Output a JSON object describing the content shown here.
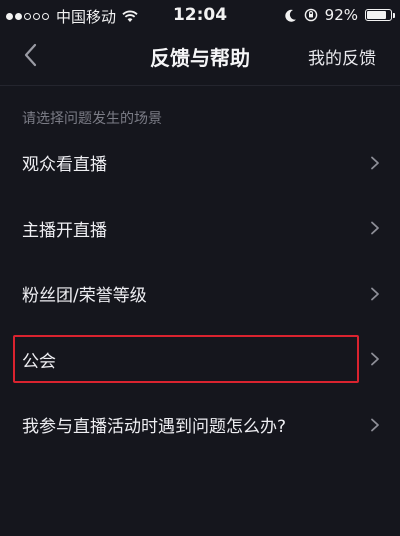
{
  "status_bar": {
    "carrier": "中国移动",
    "time": "12:04",
    "battery_text": "92%",
    "battery_level": 0.92
  },
  "nav": {
    "title": "反馈与帮助",
    "right_action": "我的反馈"
  },
  "section_hint": "请选择问题发生的场景",
  "menu_items": [
    {
      "label": "观众看直播"
    },
    {
      "label": "主播开直播"
    },
    {
      "label": "粉丝团/荣誉等级"
    },
    {
      "label": "公会",
      "highlighted": true
    },
    {
      "label": "我参与直播活动时遇到问题怎么办?"
    }
  ],
  "colors": {
    "background": "#15161d",
    "highlight_border": "#d9232f",
    "hint_text": "#7b7c86"
  }
}
